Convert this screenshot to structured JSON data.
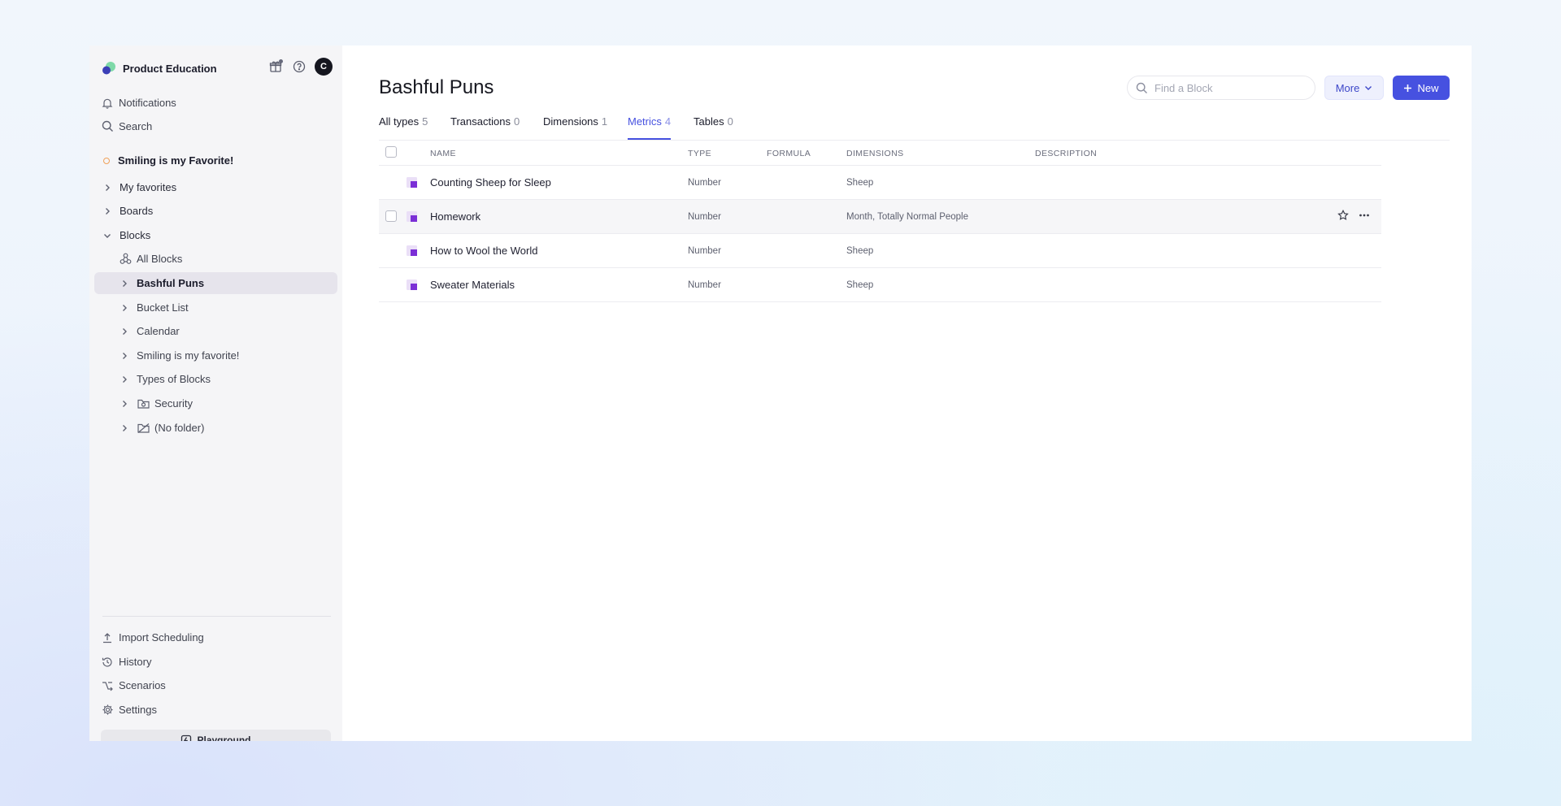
{
  "workspace": {
    "name": "Product Education",
    "avatar_initial": "C"
  },
  "sidebar": {
    "top_items": [
      {
        "label": "Notifications",
        "icon": "bell-icon"
      },
      {
        "label": "Search",
        "icon": "search-icon"
      }
    ],
    "favorite": "Smiling is my Favorite!",
    "sections": [
      {
        "label": "My favorites"
      },
      {
        "label": "Boards"
      },
      {
        "label": "Blocks"
      }
    ],
    "blocks_items": [
      {
        "label": "All Blocks",
        "icon": "all-blocks-icon"
      },
      {
        "label": "Bashful Puns"
      },
      {
        "label": "Bucket List"
      },
      {
        "label": "Calendar"
      },
      {
        "label": "Smiling is my favorite!"
      },
      {
        "label": "Types of Blocks"
      },
      {
        "label": "Security",
        "icon": "security-folder-icon"
      },
      {
        "label": "(No folder)",
        "icon": "no-folder-icon"
      }
    ],
    "bottom_items": [
      {
        "label": "Import Scheduling",
        "icon": "upload-icon"
      },
      {
        "label": "History",
        "icon": "history-icon"
      },
      {
        "label": "Scenarios",
        "icon": "scenarios-icon"
      },
      {
        "label": "Settings",
        "icon": "gear-icon"
      }
    ],
    "playground": "Playground"
  },
  "main": {
    "title": "Bashful Puns",
    "search_placeholder": "Find a Block",
    "more_label": "More",
    "new_label": "New",
    "tabs": [
      {
        "label": "All types",
        "count": "5"
      },
      {
        "label": "Transactions",
        "count": "0"
      },
      {
        "label": "Dimensions",
        "count": "1"
      },
      {
        "label": "Metrics",
        "count": "4"
      },
      {
        "label": "Tables",
        "count": "0"
      }
    ],
    "active_tab": "Metrics",
    "columns": [
      "NAME",
      "TYPE",
      "FORMULA",
      "DIMENSIONS",
      "DESCRIPTION"
    ],
    "rows": [
      {
        "name": "Counting Sheep for Sleep",
        "type": "Number",
        "formula": "",
        "dimensions": "Sheep",
        "description": ""
      },
      {
        "name": "Homework",
        "type": "Number",
        "formula": "",
        "dimensions": "Month, Totally Normal People",
        "description": ""
      },
      {
        "name": "How to Wool the World",
        "type": "Number",
        "formula": "",
        "dimensions": "Sheep",
        "description": ""
      },
      {
        "name": "Sweater Materials",
        "type": "Number",
        "formula": "",
        "dimensions": "Sheep",
        "description": ""
      }
    ]
  },
  "colors": {
    "accent": "#4651e0",
    "metric_icon": "#7b2fd6",
    "favorite_dot": "#f0a15a"
  }
}
